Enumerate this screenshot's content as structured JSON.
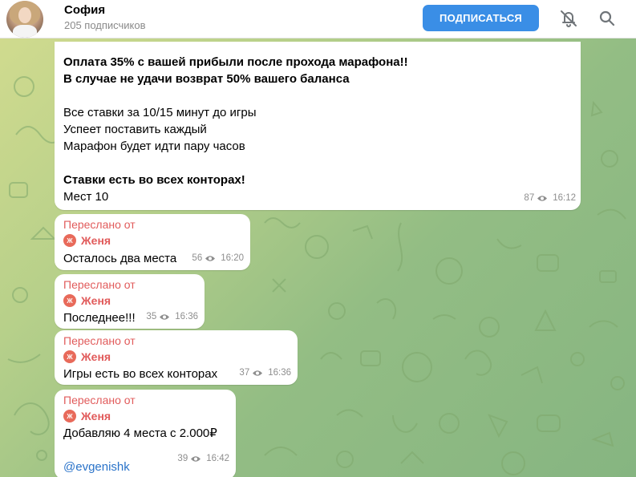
{
  "header": {
    "channel_name": "София",
    "subscribers": "205 подписчиков",
    "subscribe_label": "ПОДПИСАТЬСЯ"
  },
  "colors": {
    "accent": "#3a8ee6",
    "forward_red": "#e15b5b",
    "link": "#2a73c9"
  },
  "icons": [
    "bell-off-icon",
    "search-icon",
    "eye-icon",
    "forward-avatar-icon"
  ],
  "messages": [
    {
      "lines": [
        "Оплата 35% с вашей прибыли после прохода марафона!!",
        "В случае не удачи возврат 50% вашего баланса",
        "Все ставки за 10/15 минут до игры",
        "Успеет поставить каждый",
        "Марафон будет идти пару часов",
        "Ставки есть во всех конторах!",
        "Мест 10"
      ],
      "views": "87",
      "time": "16:12"
    },
    {
      "forwarded_label": "Переслано от",
      "forwarded_from": "Женя",
      "avatar_letter": "Ж",
      "text": "Осталось два места",
      "views": "56",
      "time": "16:20"
    },
    {
      "forwarded_label": "Переслано от",
      "forwarded_from": "Женя",
      "avatar_letter": "Ж",
      "text": "Последнее!!!",
      "views": "35",
      "time": "16:36"
    },
    {
      "forwarded_label": "Переслано от",
      "forwarded_from": "Женя",
      "avatar_letter": "Ж",
      "text": "Игры есть во всех конторах",
      "views": "37",
      "time": "16:36"
    },
    {
      "forwarded_label": "Переслано от",
      "forwarded_from": "Женя",
      "avatar_letter": "Ж",
      "text": "Добавляю 4 места с 2.000₽",
      "link": "@evgenishk",
      "views": "39",
      "time": "16:42"
    }
  ]
}
